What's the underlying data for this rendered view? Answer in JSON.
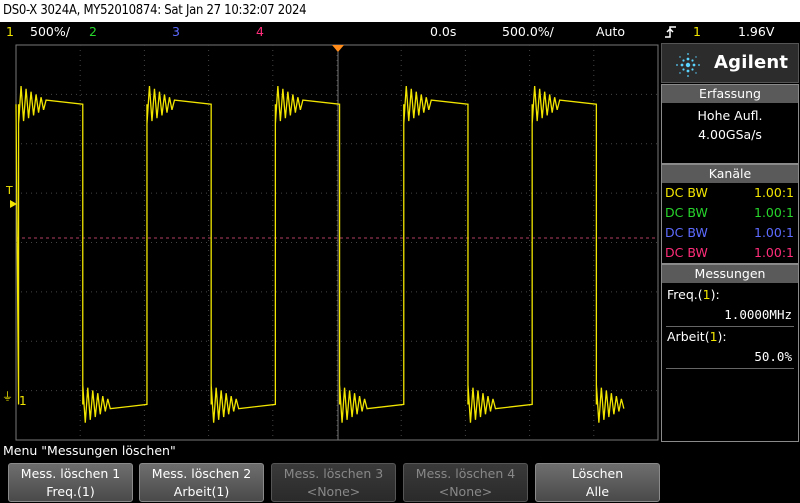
{
  "title_bar": {
    "text": "DS0-X 3024A, MY52010874: Sat Jan 27 10:32:07 2024"
  },
  "status_bar": {
    "ch1_num": "1",
    "ch1_scale": "500%/",
    "ch2_num": "2",
    "ch3_num": "3",
    "ch4_num": "4",
    "time_delay": "0.0s",
    "time_scale": "500.0%/",
    "trigger_mode": "Auto",
    "trigger_icon": "trigger-edge-icon",
    "trigger_source": "1",
    "trigger_level": "1.96V"
  },
  "colors": {
    "ch1": "#f2e600",
    "ch2": "#27d52b",
    "ch3": "#5d6bff",
    "ch4": "#ff2d7a",
    "grid": "#555555",
    "marker": "#ff8c1a"
  },
  "graticule": {
    "left_marker_T": "T",
    "left_marker_1": "1"
  },
  "waveform": {
    "channel": "1",
    "shape": "square",
    "periods_visible": 5,
    "duty_cycle": 0.5,
    "high_level": 0.85,
    "low_level": 0.09
  },
  "right_panel": {
    "brand": "Agilent",
    "brand_icon": "agilent-spark-icon",
    "acquisition": {
      "header": "Erfassung",
      "mode": "Hohe Aufl.",
      "rate": "4.00GSa/s"
    },
    "channels": {
      "header": "Kanäle",
      "rows": [
        {
          "coupling": "DC BW",
          "probe": "1.00:1"
        },
        {
          "coupling": "DC BW",
          "probe": "1.00:1"
        },
        {
          "coupling": "DC BW",
          "probe": "1.00:1"
        },
        {
          "coupling": "DC BW",
          "probe": "1.00:1"
        }
      ]
    },
    "measurements": {
      "header": "Messungen",
      "items": [
        {
          "label": "Freq.(1):",
          "label_name": "Freq.(",
          "label_ch": "1",
          "label_end": "):",
          "value": "1.0000MHz"
        },
        {
          "label": "Arbeit(1):",
          "label_name": "Arbeit(",
          "label_ch": "1",
          "label_end": "):",
          "value": "50.0%"
        }
      ]
    }
  },
  "menu": {
    "title": "Menu \"Messungen löschen\""
  },
  "softkeys": [
    {
      "line1": "Mess. löschen 1",
      "line2": "Freq.(1)",
      "enabled": true
    },
    {
      "line1": "Mess. löschen 2",
      "line2": "Arbeit(1)",
      "enabled": true
    },
    {
      "line1": "Mess. löschen 3",
      "line2": "<None>",
      "enabled": false
    },
    {
      "line1": "Mess. löschen 4",
      "line2": "<None>",
      "enabled": false
    },
    {
      "line1": "Löschen",
      "line2": "Alle",
      "enabled": true
    }
  ]
}
